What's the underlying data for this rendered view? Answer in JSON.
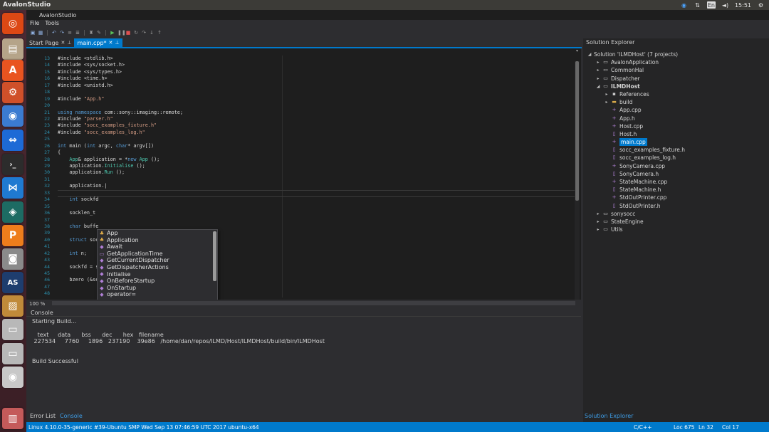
{
  "os": {
    "app_title": "AvalonStudio",
    "clock": "15:51",
    "tray_language": "En"
  },
  "window": {
    "title": "AvalonStudio"
  },
  "menu": [
    "File",
    "Tools"
  ],
  "tabs": [
    {
      "label": "Start Page",
      "active": false
    },
    {
      "label": "main.cpp*",
      "active": true
    }
  ],
  "editor": {
    "zoom": "100 %",
    "lines": [
      {
        "n": "13",
        "html": "#include &lt;stdlib.h&gt;"
      },
      {
        "n": "14",
        "html": "#include &lt;sys/socket.h&gt;"
      },
      {
        "n": "15",
        "html": "#include &lt;sys/types.h&gt;"
      },
      {
        "n": "16",
        "html": "#include &lt;time.h&gt;"
      },
      {
        "n": "17",
        "html": "#include &lt;unistd.h&gt;"
      },
      {
        "n": "18",
        "html": ""
      },
      {
        "n": "19",
        "html": "#include <span class=\"str\">\"App.h\"</span>"
      },
      {
        "n": "20",
        "html": ""
      },
      {
        "n": "21",
        "html": "<span class=\"kw\">using namespace</span> com::sony::imaging::remote;"
      },
      {
        "n": "22",
        "html": "#include <span class=\"str\">\"parser.h\"</span>"
      },
      {
        "n": "23",
        "html": "#include <span class=\"str\">\"socc_examples_fixture.h\"</span>"
      },
      {
        "n": "24",
        "html": "#include <span class=\"str\">\"socc_examples_log.h\"</span>"
      },
      {
        "n": "25",
        "html": ""
      },
      {
        "n": "26",
        "html": "<span class=\"kw\">int</span> main (<span class=\"kw\">int</span> argc, <span class=\"kw\">char</span>* argv[])"
      },
      {
        "n": "27",
        "html": "{"
      },
      {
        "n": "28",
        "html": "    <span class=\"ty\">App</span>&amp; application = *<span class=\"kw\">new</span> <span class=\"ty\">App</span> ();"
      },
      {
        "n": "29",
        "html": "    application.<span class=\"ty\">Initialise</span> ();"
      },
      {
        "n": "30",
        "html": "    application.<span class=\"ty\">Run</span> ();"
      },
      {
        "n": "31",
        "html": ""
      },
      {
        "n": "32",
        "html": "    application.|"
      },
      {
        "n": "33",
        "html": ""
      },
      {
        "n": "34",
        "html": "    <span class=\"kw\">int</span> sockfd"
      },
      {
        "n": "35",
        "html": ""
      },
      {
        "n": "36",
        "html": "    socklen_t"
      },
      {
        "n": "37",
        "html": ""
      },
      {
        "n": "38",
        "html": "    <span class=\"kw\">char</span> buffe"
      },
      {
        "n": "39",
        "html": ""
      },
      {
        "n": "40",
        "html": "    <span class=\"kw\">struct</span> soc"
      },
      {
        "n": "41",
        "html": ""
      },
      {
        "n": "42",
        "html": "    <span class=\"kw\">int</span> n;"
      },
      {
        "n": "43",
        "html": ""
      },
      {
        "n": "44",
        "html": "    sockfd = socket (AF_INET, SOCK_STREAM, 0);"
      },
      {
        "n": "45",
        "html": ""
      },
      {
        "n": "46",
        "html": "    bzero (&amp;serv_addr, <span class=\"kw\">sizeof</span> (serv_addr));"
      },
      {
        "n": "47",
        "html": ""
      },
      {
        "n": "48",
        "html": ""
      }
    ],
    "completion": [
      {
        "label": "App",
        "kind": "cls"
      },
      {
        "label": "Application",
        "kind": "cls"
      },
      {
        "label": "Await",
        "kind": "m"
      },
      {
        "label": "GetApplicationTime",
        "kind": "f"
      },
      {
        "label": "GetCurrentDispatcher",
        "kind": "m"
      },
      {
        "label": "GetDispatcherActions",
        "kind": "m"
      },
      {
        "label": "Initialise",
        "kind": "m"
      },
      {
        "label": "OnBeforeStartup",
        "kind": "m"
      },
      {
        "label": "OnStartup",
        "kind": "m"
      },
      {
        "label": "operator=",
        "kind": "m"
      }
    ]
  },
  "console": {
    "title": "Console",
    "lines": [
      "Starting Build...",
      "",
      "   text     data      bss      dec      hex   filename",
      " 227534     7760     1896   237190    39e86   /home/dan/repos/ILMD/Host/ILMDHost/build/bin/ILMDHost",
      "",
      "",
      "Build Successful"
    ],
    "tabs": [
      "Error List",
      "Console"
    ]
  },
  "solution": {
    "title": "Solution Explorer",
    "footer": "Solution Explorer",
    "tree": [
      {
        "label": "Solution 'ILMDHost' (7 projects)",
        "depth": 0,
        "arrow": "◢",
        "icon": ""
      },
      {
        "label": "AvalonApplication",
        "depth": 1,
        "arrow": "▸",
        "icon": "▭"
      },
      {
        "label": "CommonHal",
        "depth": 1,
        "arrow": "▸",
        "icon": "▭"
      },
      {
        "label": "Dispatcher",
        "depth": 1,
        "arrow": "▸",
        "icon": "▭"
      },
      {
        "label": "ILMDHost",
        "depth": 1,
        "arrow": "◢",
        "icon": "▭",
        "bold": true
      },
      {
        "label": "References",
        "depth": 2,
        "arrow": "▸",
        "icon": "▪"
      },
      {
        "label": "build",
        "depth": 2,
        "arrow": "▸",
        "icon": "▬",
        "kind": "folder"
      },
      {
        "label": "App.cpp",
        "depth": 2,
        "arrow": "",
        "icon": "+",
        "kind": "cpp"
      },
      {
        "label": "App.h",
        "depth": 2,
        "arrow": "",
        "icon": "+",
        "kind": "cpp"
      },
      {
        "label": "Host.cpp",
        "depth": 2,
        "arrow": "",
        "icon": "+",
        "kind": "cpp"
      },
      {
        "label": "Host.h",
        "depth": 2,
        "arrow": "",
        "icon": "▯",
        "kind": "h"
      },
      {
        "label": "main.cpp",
        "depth": 2,
        "arrow": "",
        "icon": "+",
        "kind": "cpp",
        "selected": true
      },
      {
        "label": "socc_examples_fixture.h",
        "depth": 2,
        "arrow": "",
        "icon": "▯",
        "kind": "h"
      },
      {
        "label": "socc_examples_log.h",
        "depth": 2,
        "arrow": "",
        "icon": "▯",
        "kind": "h"
      },
      {
        "label": "SonyCamera.cpp",
        "depth": 2,
        "arrow": "",
        "icon": "+",
        "kind": "cpp"
      },
      {
        "label": "SonyCamera.h",
        "depth": 2,
        "arrow": "",
        "icon": "▯",
        "kind": "h"
      },
      {
        "label": "StateMachine.cpp",
        "depth": 2,
        "arrow": "",
        "icon": "+",
        "kind": "cpp"
      },
      {
        "label": "StateMachine.h",
        "depth": 2,
        "arrow": "",
        "icon": "▯",
        "kind": "h"
      },
      {
        "label": "StdOutPrinter.cpp",
        "depth": 2,
        "arrow": "",
        "icon": "+",
        "kind": "cpp"
      },
      {
        "label": "StdOutPrinter.h",
        "depth": 2,
        "arrow": "",
        "icon": "▯",
        "kind": "h"
      },
      {
        "label": "sonysocc",
        "depth": 1,
        "arrow": "▸",
        "icon": "▭"
      },
      {
        "label": "StateEngine",
        "depth": 1,
        "arrow": "▸",
        "icon": "▭"
      },
      {
        "label": "Utils",
        "depth": 1,
        "arrow": "▸",
        "icon": "▭"
      }
    ]
  },
  "status": {
    "text": "Linux 4.10.0-35-generic #39-Ubuntu SMP Wed Sep 13 07:46:59 UTC 2017 ubuntu-x64",
    "language": "C/C++",
    "loc": "Loc 675",
    "ln": "Ln 32",
    "col": "Col 17"
  },
  "launcher_icons": [
    {
      "name": "ubuntu-logo-icon",
      "color": "#dd4814",
      "glyph": "◎"
    },
    {
      "name": "files-icon",
      "color": "#b5a489",
      "glyph": "▤"
    },
    {
      "name": "software-center-icon",
      "color": "#e95420",
      "glyph": "A"
    },
    {
      "name": "settings-icon",
      "color": "#d0502a",
      "glyph": "⚙"
    },
    {
      "name": "chromium-icon",
      "color": "#3b7bd1",
      "glyph": "◉"
    },
    {
      "name": "teamviewer-icon",
      "color": "#1d6ad6",
      "glyph": "⇔"
    },
    {
      "name": "terminal-icon",
      "color": "#2c2c2c",
      "glyph": "›_"
    },
    {
      "name": "vscode-icon",
      "color": "#1f7ad1",
      "glyph": "⋈"
    },
    {
      "name": "gitkraken-icon",
      "color": "#1d6b63",
      "glyph": "◈"
    },
    {
      "name": "p-app-icon",
      "color": "#ee7d1c",
      "glyph": "P"
    },
    {
      "name": "camera-icon",
      "color": "#8a8a8a",
      "glyph": "◙"
    },
    {
      "name": "avalonstudio-icon",
      "color": "#1e3d6e",
      "glyph": "AS"
    },
    {
      "name": "image-viewer-icon",
      "color": "#c08a3a",
      "glyph": "▨"
    },
    {
      "name": "drive-icon",
      "color": "#b8b8b8",
      "glyph": "▭"
    },
    {
      "name": "drive-2-icon",
      "color": "#b8b8b8",
      "glyph": "▭"
    },
    {
      "name": "dvd-icon",
      "color": "#c8c8c8",
      "glyph": "◉"
    },
    {
      "name": "trash-icon",
      "color": "#c45a5a",
      "glyph": "▥"
    }
  ]
}
